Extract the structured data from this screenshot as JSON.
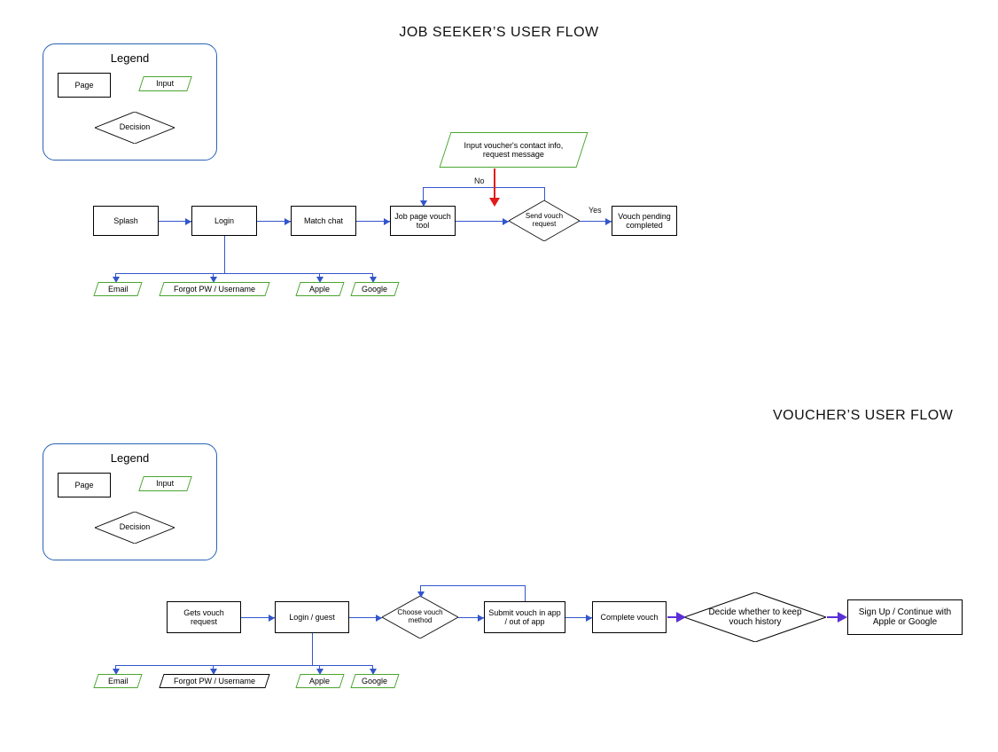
{
  "titles": {
    "job_seeker": "JOB SEEKER’S USER FLOW",
    "voucher": "VOUCHER’S USER FLOW"
  },
  "legend": {
    "heading": "Legend",
    "page": "Page",
    "input": "Input",
    "decision": "Decision"
  },
  "job_seeker": {
    "nodes": {
      "splash": "Splash",
      "login": "Login",
      "match_chat": "Match chat",
      "job_page_vouch_tool": "Job page vouch tool",
      "input_voucher_contact": "Input voucher's contact info, request message",
      "send_vouch_request": "Send vouch request",
      "vouch_pending_completed": "Vouch pending completed"
    },
    "login_options": {
      "email": "Email",
      "forgot": "Forgot PW / Username",
      "apple": "Apple",
      "google": "Google"
    },
    "edge_labels": {
      "no": "No",
      "yes": "Yes"
    }
  },
  "voucher": {
    "nodes": {
      "gets_vouch_request": "Gets vouch request",
      "login_guest": "Login / guest",
      "choose_vouch_method": "Choose vouch method",
      "submit_vouch": "Submit vouch in app / out of app",
      "complete_vouch": "Complete vouch",
      "decide_history": "Decide whether to keep vouch history",
      "sign_up_continue": "Sign Up / Continue with Apple or Google"
    },
    "login_options": {
      "email": "Email",
      "forgot": "Forgot PW / Username",
      "apple": "Apple",
      "google": "Google"
    }
  }
}
